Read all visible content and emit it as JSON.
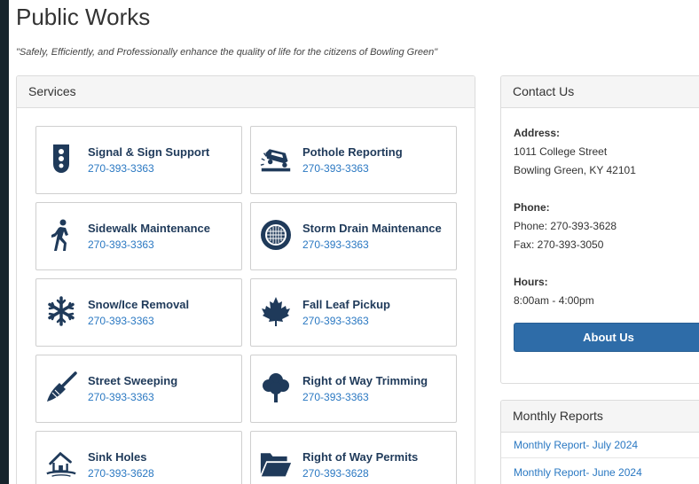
{
  "header": {
    "title": "Public Works",
    "tagline": "\"Safely, Efficiently, and Professionally enhance the quality of life for the citizens of Bowling Green\""
  },
  "services": {
    "heading": "Services",
    "items": [
      {
        "name": "Signal & Sign Support",
        "phone": "270-393-3363",
        "icon": "traffic-signal-icon"
      },
      {
        "name": "Pothole Reporting",
        "phone": "270-393-3363",
        "icon": "pothole-car-icon"
      },
      {
        "name": "Sidewalk Maintenance",
        "phone": "270-393-3363",
        "icon": "walking-person-icon"
      },
      {
        "name": "Storm Drain Maintenance",
        "phone": "270-393-3363",
        "icon": "storm-drain-icon"
      },
      {
        "name": "Snow/Ice Removal",
        "phone": "270-393-3363",
        "icon": "snowflake-icon"
      },
      {
        "name": "Fall Leaf Pickup",
        "phone": "270-393-3363",
        "icon": "maple-leaf-icon"
      },
      {
        "name": "Street Sweeping",
        "phone": "270-393-3363",
        "icon": "broom-icon"
      },
      {
        "name": "Right of Way Trimming",
        "phone": "270-393-3363",
        "icon": "tree-icon"
      },
      {
        "name": "Sink Holes",
        "phone": "270-393-3628",
        "icon": "sinkhole-house-icon"
      },
      {
        "name": "Right of Way Permits",
        "phone": "270-393-3628",
        "icon": "folder-icon"
      }
    ]
  },
  "contact": {
    "heading": "Contact Us",
    "address_label": "Address:",
    "address_line1": "1011 College Street",
    "address_line2": "Bowling Green, KY 42101",
    "phone_label": "Phone:",
    "phone": "Phone: 270-393-3628",
    "fax": "Fax: 270-393-3050",
    "hours_label": "Hours:",
    "hours": "8:00am - 4:00pm",
    "about_button": "About Us"
  },
  "reports": {
    "heading": "Monthly Reports",
    "items": [
      "Monthly Report- July 2024",
      "Monthly Report- June 2024"
    ]
  },
  "colors": {
    "icon": "#1f3a5a",
    "link": "#2a78c2",
    "button": "#2e6ca8",
    "frame": "#16242c"
  }
}
